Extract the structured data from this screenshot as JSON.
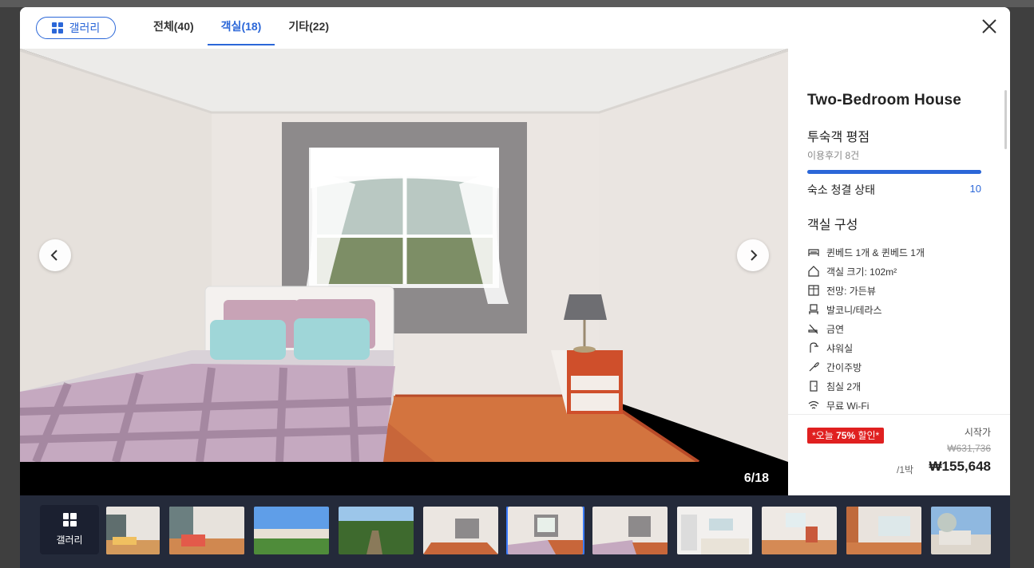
{
  "header": {
    "gallery_label": "갤러리",
    "tabs": [
      {
        "label": "전체",
        "count": "(40)"
      },
      {
        "label": "객실",
        "count": "(18)"
      },
      {
        "label": "기타",
        "count": "(22)"
      }
    ],
    "active_tab": 1
  },
  "viewer": {
    "counter": "6/18",
    "current_index": 6,
    "total": 18
  },
  "info": {
    "room_name": "Two-Bedroom House",
    "rating_title": "투숙객 평점",
    "review_count": "이용후기 8건",
    "clean_label": "숙소 청결 상태",
    "clean_score": "10",
    "clean_fraction": 1.0,
    "config_title": "객실 구성",
    "amenities": [
      {
        "icon": "bed-icon",
        "label": "퀸베드 1개 & 퀸베드 1개"
      },
      {
        "icon": "house-size-icon",
        "label": "객실 크기: 102m²"
      },
      {
        "icon": "window-view-icon",
        "label": "전망: 가든뷰"
      },
      {
        "icon": "balcony-icon",
        "label": "발코니/테라스"
      },
      {
        "icon": "no-smoking-icon",
        "label": "금연"
      },
      {
        "icon": "shower-icon",
        "label": "샤워실"
      },
      {
        "icon": "kitchen-icon",
        "label": "간이주방"
      },
      {
        "icon": "door-icon",
        "label": "침실 2개"
      },
      {
        "icon": "wifi-icon",
        "label": "무료 Wi-Fi"
      }
    ]
  },
  "price": {
    "deal_prefix": "*오늘 ",
    "deal_percent": "75%",
    "deal_suffix": " 할인*",
    "start_label": "시작가",
    "original": "₩631,736",
    "per_night": "/1박",
    "final": "₩155,648"
  },
  "strip": {
    "gallery_label": "갤러리"
  },
  "colors": {
    "accent": "#2b67d8",
    "deal": "#e02020",
    "strip_bg": "#242a3a"
  }
}
